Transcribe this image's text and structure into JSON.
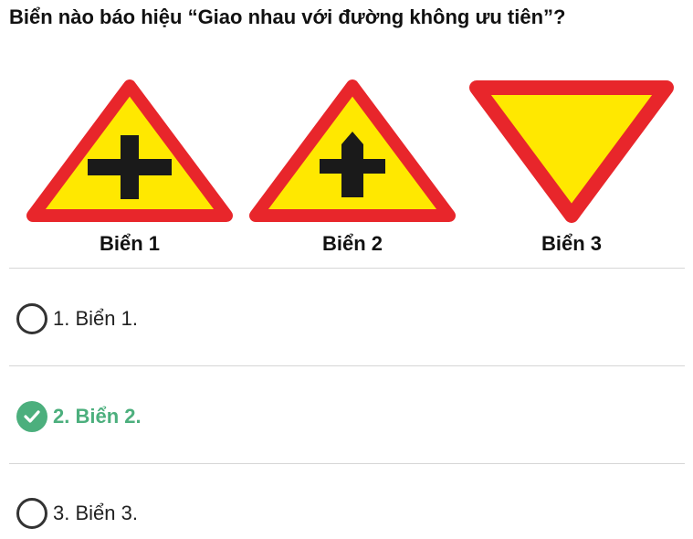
{
  "question": "Biển nào báo hiệu “Giao nhau với đường không ưu tiên”?",
  "signs": [
    {
      "caption": "Biển 1",
      "icon": "crossroad-warning-triangle-icon"
    },
    {
      "caption": "Biển 2",
      "icon": "priority-road-junction-triangle-icon"
    },
    {
      "caption": "Biển 3",
      "icon": "give-way-inverted-triangle-icon"
    }
  ],
  "options": [
    {
      "label": "1. Biển 1.",
      "selected": false
    },
    {
      "label": "2. Biển 2.",
      "selected": true
    },
    {
      "label": "3. Biển 3.",
      "selected": false
    }
  ],
  "colors": {
    "sign_red": "#e8262b",
    "sign_yellow": "#ffe800",
    "symbol_black": "#1a1a1a",
    "correct_green": "#4caf7d"
  }
}
